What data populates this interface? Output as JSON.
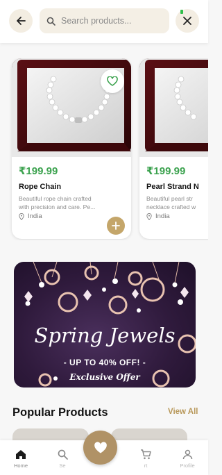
{
  "header": {
    "search_placeholder": "Search products..."
  },
  "products": [
    {
      "price": "₹199.99",
      "name": "Rope Chain",
      "description_line1": "Beautiful rope chain crafted",
      "description_line2": "with precision and care. Pe...",
      "location": "India"
    },
    {
      "price": "₹199.99",
      "name": "Pearl Strand N",
      "description_line1": "Beautiful pearl str",
      "description_line2": "necklace crafted w",
      "location": "India"
    }
  ],
  "banner": {
    "title": "Spring Jewels",
    "subtitle": "- UP TO 40% OFF! -",
    "tagline": "Exclusive Offer"
  },
  "popular": {
    "title": "Popular Products",
    "view_all": "View All"
  },
  "nav": {
    "home": "Home",
    "search": "Se",
    "cart": "rt",
    "profile": "Profile"
  },
  "colors": {
    "price_green": "#3ba24e",
    "accent_gold": "#c4a66a",
    "fab_brown": "#b09266"
  }
}
